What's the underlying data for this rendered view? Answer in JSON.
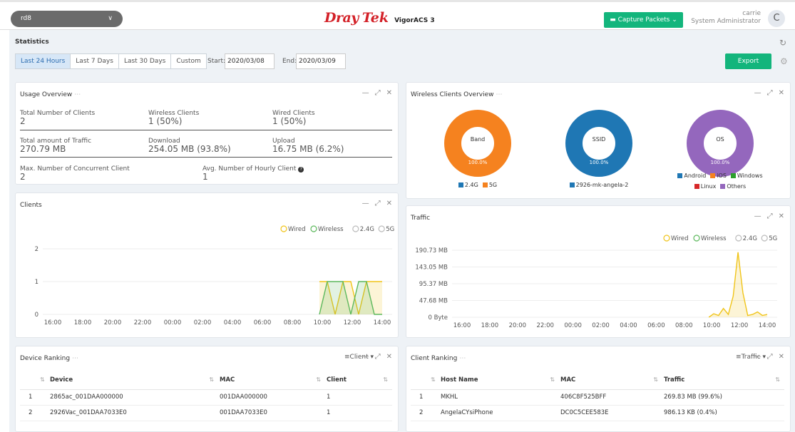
{
  "header": {
    "site": "rd8",
    "brand_dray": "Dray",
    "brand_tek": "Tek",
    "product": "VigorACS 3",
    "capture_label": "Capture Packets",
    "username": "carrie",
    "role": "System Administrator",
    "avatar_letter": "C"
  },
  "stats": {
    "title": "Statistics",
    "tabs": [
      "Last 24 Hours",
      "Last 7 Days",
      "Last 30 Days",
      "Custom"
    ],
    "start_label": "Start:",
    "start_value": "2020/03/08",
    "end_label": "End:",
    "end_value": "2020/03/09",
    "export_label": "Export"
  },
  "usage": {
    "title": "Usage Overview",
    "total_clients_label": "Total Number of Clients",
    "total_clients": "2",
    "wireless_label": "Wireless Clients",
    "wireless": "1 (50%)",
    "wired_label": "Wired Clients",
    "wired": "1 (50%)",
    "traffic_label": "Total amount of Traffic",
    "traffic": "270.79 MB",
    "download_label": "Download",
    "download": "254.05 MB (93.8%)",
    "upload_label": "Upload",
    "upload": "16.75 MB (6.2%)",
    "max_label": "Max. Number of Concurrent Client",
    "max": "2",
    "avg_label": "Avg. Number of Hourly Client",
    "avg": "1"
  },
  "wireless_overview": {
    "title": "Wireless Clients Overview",
    "donuts": [
      {
        "label": "Band",
        "percent": "100.0%",
        "color": "#f5821f",
        "legend": [
          {
            "name": "2.4G",
            "color": "#1f77b4"
          },
          {
            "name": "5G",
            "color": "#f5821f"
          }
        ]
      },
      {
        "label": "SSID",
        "percent": "100.0%",
        "color": "#1f77b4",
        "legend": [
          {
            "name": "2926-mk-angela-2",
            "color": "#1f77b4"
          }
        ]
      },
      {
        "label": "OS",
        "percent": "100.0%",
        "color": "#9467bd",
        "legend": [
          {
            "name": "Android",
            "color": "#1f77b4"
          },
          {
            "name": "iOS",
            "color": "#f5821f"
          },
          {
            "name": "Windows",
            "color": "#2ca02c"
          },
          {
            "name": "Linux",
            "color": "#d62728"
          },
          {
            "name": "Others",
            "color": "#9467bd"
          }
        ]
      }
    ]
  },
  "clients_chart": {
    "title": "Clients",
    "legend": [
      {
        "name": "Wired",
        "color": "#f0c419"
      },
      {
        "name": "Wireless",
        "color": "#5cb85c"
      },
      {
        "name": "2.4G",
        "color": "#bbb"
      },
      {
        "name": "5G",
        "color": "#bbb"
      }
    ],
    "y_ticks": [
      "2",
      "1",
      "0"
    ],
    "x_ticks": [
      "16:00",
      "18:00",
      "20:00",
      "22:00",
      "00:00",
      "02:00",
      "04:00",
      "06:00",
      "08:00",
      "10:00",
      "12:00",
      "14:00"
    ]
  },
  "traffic_chart": {
    "title": "Traffic",
    "legend": [
      {
        "name": "Wired",
        "color": "#f0c419"
      },
      {
        "name": "Wireless",
        "color": "#5cb85c"
      },
      {
        "name": "2.4G",
        "color": "#bbb"
      },
      {
        "name": "5G",
        "color": "#bbb"
      }
    ],
    "y_ticks": [
      "190.73 MB",
      "143.05 MB",
      "95.37 MB",
      "47.68 MB",
      "0 Byte"
    ],
    "x_ticks": [
      "16:00",
      "18:00",
      "20:00",
      "22:00",
      "00:00",
      "02:00",
      "04:00",
      "06:00",
      "08:00",
      "10:00",
      "12:00",
      "14:00"
    ]
  },
  "chart_data": [
    {
      "type": "area",
      "title": "Clients",
      "x": [
        "10:00",
        "10:30",
        "11:00",
        "11:30",
        "12:00",
        "12:30",
        "13:00",
        "13:30",
        "14:00"
      ],
      "series": [
        {
          "name": "Wired",
          "values": [
            1,
            1,
            0,
            1,
            1,
            0,
            1,
            1,
            1
          ]
        },
        {
          "name": "Wireless",
          "values": [
            0,
            1,
            1,
            1,
            0,
            1,
            1,
            0,
            0
          ]
        }
      ],
      "ylim": [
        0,
        2
      ]
    },
    {
      "type": "area",
      "title": "Traffic",
      "x": [
        "10:00",
        "10:20",
        "10:40",
        "11:00",
        "11:20",
        "11:40",
        "12:00",
        "12:20",
        "12:40",
        "13:00",
        "13:20",
        "13:40",
        "14:00"
      ],
      "series": [
        {
          "name": "Wired",
          "values": [
            0,
            10,
            5,
            25,
            8,
            60,
            185,
            70,
            5,
            8,
            15,
            5,
            8
          ]
        }
      ],
      "ylim": [
        0,
        190.73
      ]
    }
  ],
  "device_ranking": {
    "title": "Device Ranking",
    "selector": "Client",
    "columns": [
      "Device",
      "MAC",
      "Client"
    ],
    "rows": [
      {
        "n": "1",
        "device": "2865ac_001DAA000000",
        "mac": "001DAA000000",
        "client": "1"
      },
      {
        "n": "2",
        "device": "2926Vac_001DAA7033E0",
        "mac": "001DAA7033E0",
        "client": "1"
      }
    ]
  },
  "client_ranking": {
    "title": "Client Ranking",
    "selector": "Traffic",
    "columns": [
      "Host Name",
      "MAC",
      "Traffic"
    ],
    "rows": [
      {
        "n": "1",
        "host": "MKHL",
        "mac": "406C8F525BFF",
        "traffic": "269.83 MB (99.6%)"
      },
      {
        "n": "2",
        "host": "AngelaCYsiPhone",
        "mac": "DC0C5CEE583E",
        "traffic": "986.13 KB (0.4%)"
      }
    ]
  }
}
